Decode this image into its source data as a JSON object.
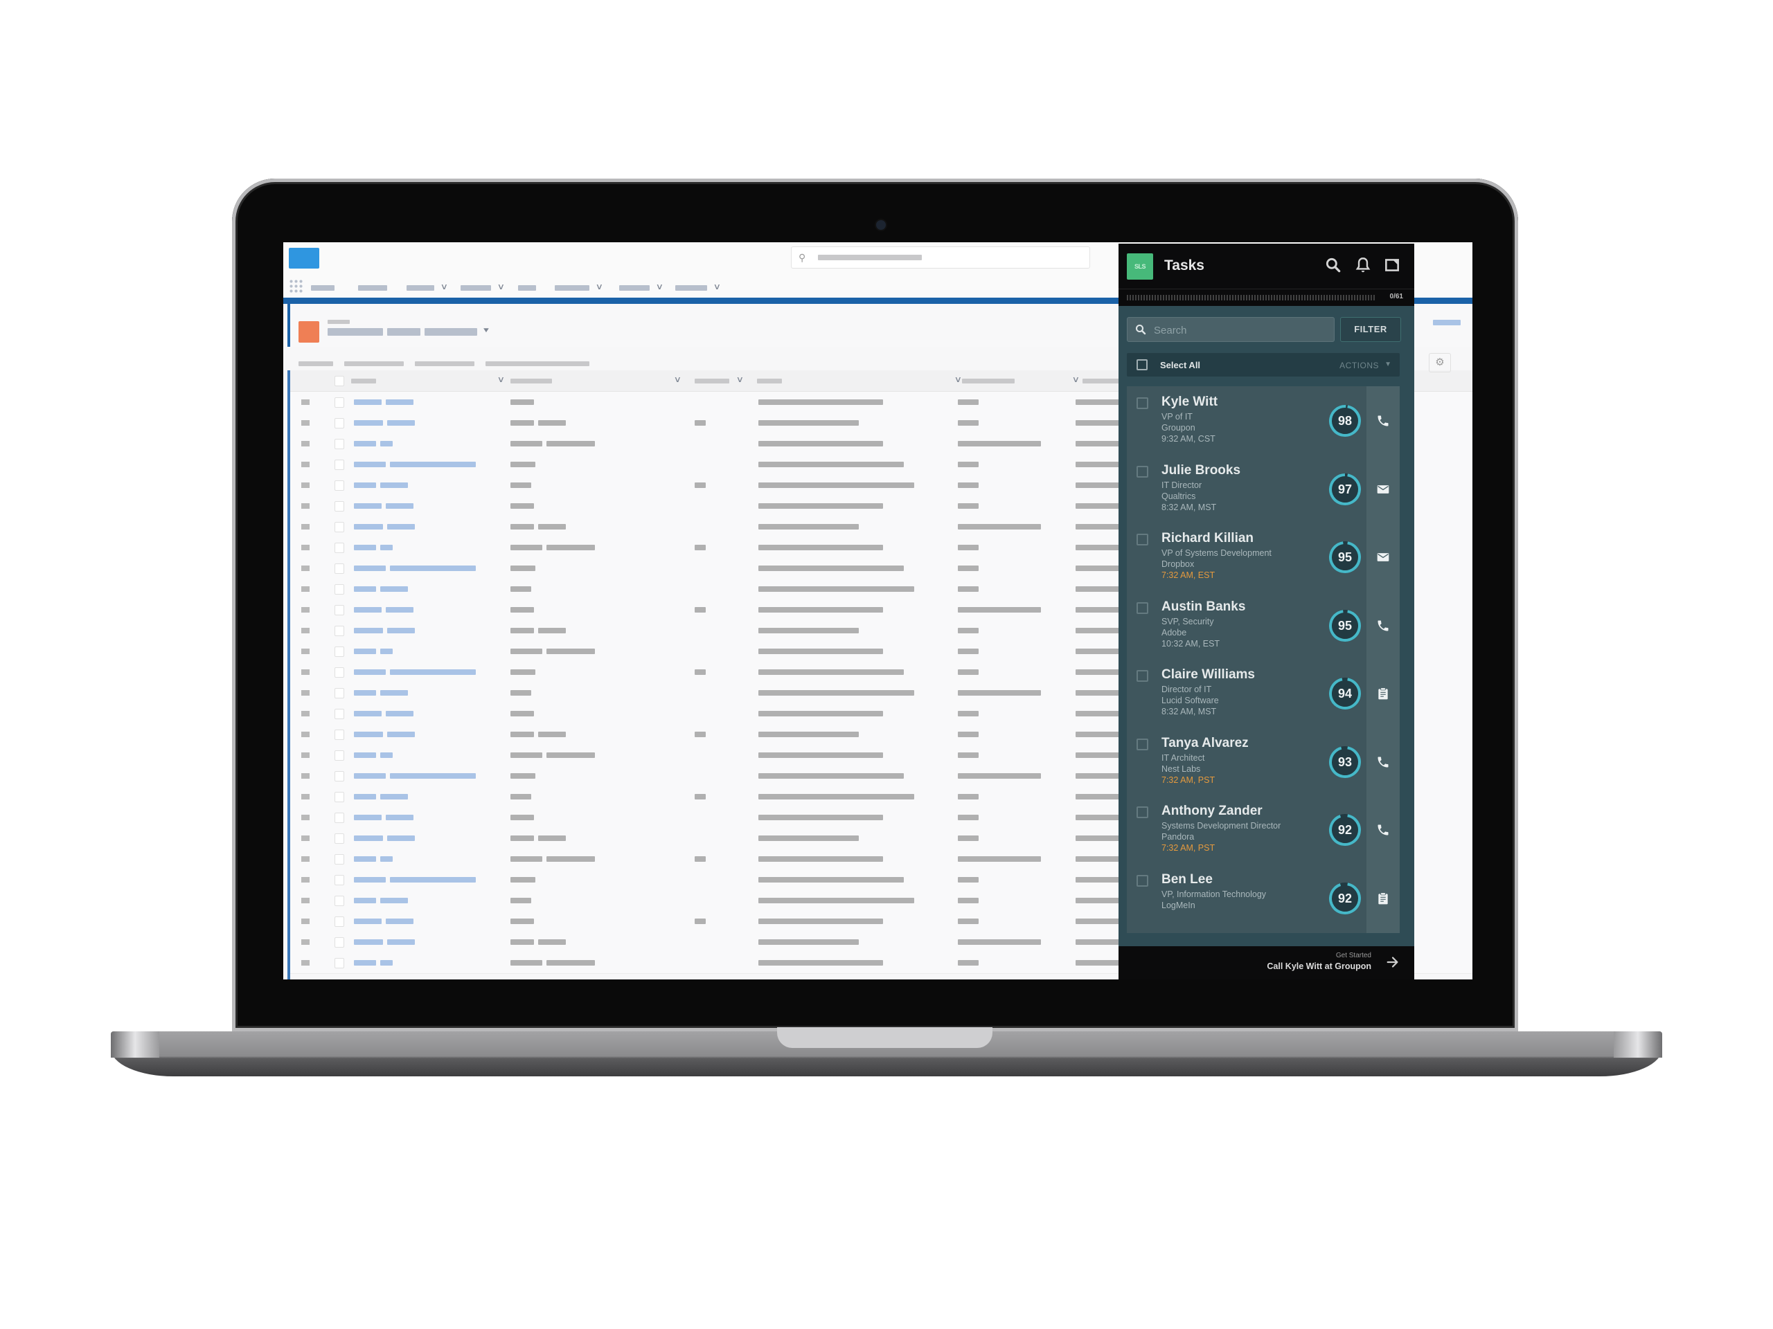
{
  "tasks_panel": {
    "logo_icon": "app-logo-icon",
    "title": "Tasks",
    "header_icons": [
      "search-icon",
      "bell-icon",
      "popout-icon"
    ],
    "progress": {
      "completed": 0,
      "total": 61,
      "label": "0/61"
    },
    "search": {
      "placeholder": "Search",
      "value": ""
    },
    "filter_label": "FILTER",
    "select_all_label": "Select All",
    "actions_label": "ACTIONS",
    "accent_color": "#46b8c8",
    "late_time_color": "#e59a3e",
    "tasks": [
      {
        "name": "Kyle Witt",
        "title": "VP of IT",
        "company": "Groupon",
        "time": "9:32 AM, CST",
        "late": false,
        "score": 98,
        "action": "phone-icon"
      },
      {
        "name": "Julie Brooks",
        "title": "IT Director",
        "company": "Qualtrics",
        "time": "8:32 AM, MST",
        "late": false,
        "score": 97,
        "action": "email-icon"
      },
      {
        "name": "Richard Killian",
        "title": "VP of Systems Development",
        "company": "Dropbox",
        "time": "7:32 AM, EST",
        "late": true,
        "score": 95,
        "action": "email-icon"
      },
      {
        "name": "Austin Banks",
        "title": "SVP, Security",
        "company": "Adobe",
        "time": "10:32 AM, EST",
        "late": false,
        "score": 95,
        "action": "phone-icon"
      },
      {
        "name": "Claire Williams",
        "title": "Director of IT",
        "company": "Lucid Software",
        "time": "8:32 AM, MST",
        "late": false,
        "score": 94,
        "action": "clipboard-icon"
      },
      {
        "name": "Tanya Alvarez",
        "title": "IT Architect",
        "company": "Nest Labs",
        "time": "7:32 AM, PST",
        "late": true,
        "score": 93,
        "action": "phone-icon"
      },
      {
        "name": "Anthony Zander",
        "title": "Systems Development Director",
        "company": "Pandora",
        "time": "7:32 AM, PST",
        "late": true,
        "score": 92,
        "action": "phone-icon"
      },
      {
        "name": "Ben Lee",
        "title": "VP, Information Technology",
        "company": "LogMeIn",
        "time": "",
        "late": false,
        "score": 92,
        "action": "clipboard-icon"
      }
    ],
    "footer": {
      "kicker": "Get Started",
      "cta": "Call Kyle Witt at Groupon",
      "icon": "arrow-right-icon"
    }
  },
  "crm_background": {
    "note": "blurred placeholder app content; no legible text",
    "brand_color": "#1b62a8",
    "object_icon_color": "#ef7f55",
    "row_count": 28
  }
}
